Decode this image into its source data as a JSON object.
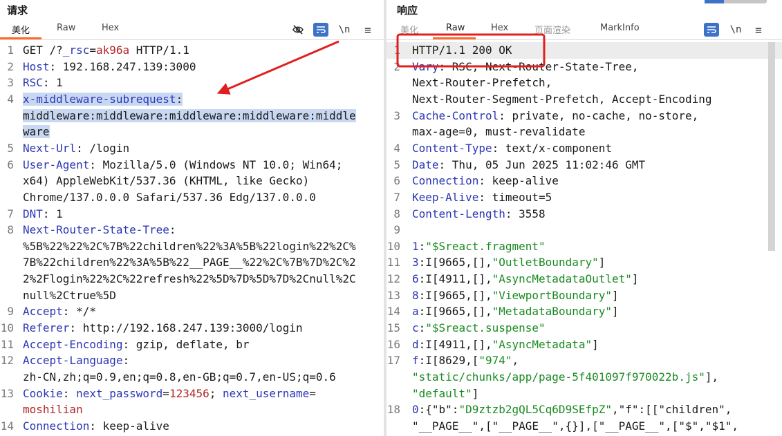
{
  "request": {
    "title": "请求",
    "tabs": [
      "美化",
      "Raw",
      "Hex"
    ],
    "lines": [
      {
        "n": "1",
        "parts": [
          [
            "GET /?",
            "v"
          ],
          [
            "_rsc",
            "k"
          ],
          [
            "=",
            "v"
          ],
          [
            "ak96a",
            "r"
          ],
          [
            " HTTP/1.1",
            "v"
          ]
        ]
      },
      {
        "n": "2",
        "parts": [
          [
            "Host",
            "k"
          ],
          [
            ": 192.168.247.139:3000",
            "v"
          ]
        ]
      },
      {
        "n": "3",
        "parts": [
          [
            "RSC",
            "k"
          ],
          [
            ": 1",
            "v"
          ]
        ]
      },
      {
        "n": "4",
        "parts": [
          [
            "x-middleware-subrequest",
            "k"
          ],
          [
            ":",
            "v"
          ]
        ],
        "sel": true
      },
      {
        "n": "",
        "parts": [
          [
            "middleware:middleware:middleware:middleware:middle",
            "v"
          ]
        ],
        "sel": true
      },
      {
        "n": "",
        "parts": [
          [
            "ware",
            "v"
          ]
        ],
        "sel": true
      },
      {
        "n": "5",
        "parts": [
          [
            "Next-Url",
            "k"
          ],
          [
            ": /login",
            "v"
          ]
        ]
      },
      {
        "n": "6",
        "parts": [
          [
            "User-Agent",
            "k"
          ],
          [
            ": Mozilla/5.0 (Windows NT 10.0; Win64;",
            "v"
          ]
        ]
      },
      {
        "n": "",
        "parts": [
          [
            "x64) AppleWebKit/537.36 (KHTML, like Gecko)",
            "v"
          ]
        ]
      },
      {
        "n": "",
        "parts": [
          [
            "Chrome/137.0.0.0 Safari/537.36 Edg/137.0.0.0",
            "v"
          ]
        ]
      },
      {
        "n": "7",
        "parts": [
          [
            "DNT",
            "k"
          ],
          [
            ": 1",
            "v"
          ]
        ]
      },
      {
        "n": "8",
        "parts": [
          [
            "Next-Router-State-Tree",
            "k"
          ],
          [
            ":",
            "v"
          ]
        ]
      },
      {
        "n": "",
        "parts": [
          [
            "%5B%22%22%2C%7B%22children%22%3A%5B%22login%22%2C%",
            "v"
          ]
        ]
      },
      {
        "n": "",
        "parts": [
          [
            "7B%22children%22%3A%5B%22__PAGE__%22%2C%7B%7D%2C%2",
            "v"
          ]
        ]
      },
      {
        "n": "",
        "parts": [
          [
            "2%2Flogin%22%2C%22refresh%22%5D%7D%5D%7D%2Cnull%2C",
            "v"
          ]
        ]
      },
      {
        "n": "",
        "parts": [
          [
            "null%2Ctrue%5D",
            "v"
          ]
        ]
      },
      {
        "n": "9",
        "parts": [
          [
            "Accept",
            "k"
          ],
          [
            ": */*",
            "v"
          ]
        ]
      },
      {
        "n": "10",
        "parts": [
          [
            "Referer",
            "k"
          ],
          [
            ": http://192.168.247.139:3000/login",
            "v"
          ]
        ]
      },
      {
        "n": "11",
        "parts": [
          [
            "Accept-Encoding",
            "k"
          ],
          [
            ": gzip, deflate, br",
            "v"
          ]
        ]
      },
      {
        "n": "12",
        "parts": [
          [
            "Accept-Language",
            "k"
          ],
          [
            ":",
            "v"
          ]
        ]
      },
      {
        "n": "",
        "parts": [
          [
            "zh-CN,zh;q=0.9,en;q=0.8,en-GB;q=0.7,en-US;q=0.6",
            "v"
          ]
        ]
      },
      {
        "n": "13",
        "parts": [
          [
            "Cookie",
            "k"
          ],
          [
            ": ",
            "v"
          ],
          [
            "next_password",
            "k"
          ],
          [
            "=",
            "v"
          ],
          [
            "123456",
            "r"
          ],
          [
            "; ",
            "v"
          ],
          [
            "next_username",
            "k"
          ],
          [
            "=",
            "v"
          ]
        ]
      },
      {
        "n": "",
        "parts": [
          [
            "moshilian",
            "r"
          ]
        ]
      },
      {
        "n": "14",
        "parts": [
          [
            "Connection",
            "k"
          ],
          [
            ": keep-alive",
            "v"
          ]
        ]
      }
    ]
  },
  "response": {
    "title": "响应",
    "tabs": [
      "美化",
      "Raw",
      "Hex",
      "页面渲染",
      "MarkInfo"
    ],
    "lines": [
      {
        "n": "1",
        "parts": [
          [
            "HTTP/1.1 200 OK",
            "v"
          ]
        ]
      },
      {
        "n": "2",
        "parts": [
          [
            "Vary",
            "k"
          ],
          [
            ": RSC, Next-Router-State-Tree,",
            "v"
          ]
        ]
      },
      {
        "n": "",
        "parts": [
          [
            "Next-Router-Prefetch,",
            "v"
          ]
        ]
      },
      {
        "n": "",
        "parts": [
          [
            "Next-Router-Segment-Prefetch, Accept-Encoding",
            "v"
          ]
        ]
      },
      {
        "n": "3",
        "parts": [
          [
            "Cache-Control",
            "k"
          ],
          [
            ": private, no-cache, no-store,",
            "v"
          ]
        ]
      },
      {
        "n": "",
        "parts": [
          [
            "max-age=0, must-revalidate",
            "v"
          ]
        ]
      },
      {
        "n": "4",
        "parts": [
          [
            "Content-Type",
            "k"
          ],
          [
            ": text/x-component",
            "v"
          ]
        ]
      },
      {
        "n": "5",
        "parts": [
          [
            "Date",
            "k"
          ],
          [
            ": Thu, 05 Jun 2025 11:02:46 GMT",
            "v"
          ]
        ]
      },
      {
        "n": "6",
        "parts": [
          [
            "Connection",
            "k"
          ],
          [
            ": keep-alive",
            "v"
          ]
        ]
      },
      {
        "n": "7",
        "parts": [
          [
            "Keep-Alive",
            "k"
          ],
          [
            ": timeout=5",
            "v"
          ]
        ]
      },
      {
        "n": "8",
        "parts": [
          [
            "Content-Length",
            "k"
          ],
          [
            ": 3558",
            "v"
          ]
        ]
      },
      {
        "n": "9",
        "parts": [
          [
            "",
            "v"
          ]
        ]
      },
      {
        "n": "10",
        "parts": [
          [
            "1",
            "k"
          ],
          [
            ":",
            "v"
          ],
          [
            "\"$Sreact.fragment\"",
            "s"
          ]
        ]
      },
      {
        "n": "11",
        "parts": [
          [
            "3",
            "k"
          ],
          [
            ":I[9665,[],",
            "v"
          ],
          [
            "\"OutletBoundary\"",
            "s"
          ],
          [
            "]",
            "v"
          ]
        ]
      },
      {
        "n": "12",
        "parts": [
          [
            "6",
            "k"
          ],
          [
            ":I[4911,[],",
            "v"
          ],
          [
            "\"AsyncMetadataOutlet\"",
            "s"
          ],
          [
            "]",
            "v"
          ]
        ]
      },
      {
        "n": "13",
        "parts": [
          [
            "8",
            "k"
          ],
          [
            ":I[9665,[],",
            "v"
          ],
          [
            "\"ViewportBoundary\"",
            "s"
          ],
          [
            "]",
            "v"
          ]
        ]
      },
      {
        "n": "14",
        "parts": [
          [
            "a",
            "k"
          ],
          [
            ":I[9665,[],",
            "v"
          ],
          [
            "\"MetadataBoundary\"",
            "s"
          ],
          [
            "]",
            "v"
          ]
        ]
      },
      {
        "n": "15",
        "parts": [
          [
            "c",
            "k"
          ],
          [
            ":",
            "v"
          ],
          [
            "\"$Sreact.suspense\"",
            "s"
          ]
        ]
      },
      {
        "n": "16",
        "parts": [
          [
            "d",
            "k"
          ],
          [
            ":I[4911,[],",
            "v"
          ],
          [
            "\"AsyncMetadata\"",
            "s"
          ],
          [
            "]",
            "v"
          ]
        ]
      },
      {
        "n": "17",
        "parts": [
          [
            "f",
            "k"
          ],
          [
            ":I[8629,[",
            "v"
          ],
          [
            "\"974\"",
            "s"
          ],
          [
            ",",
            "v"
          ]
        ]
      },
      {
        "n": "",
        "parts": [
          [
            "\"static/chunks/app/page-5f401097f970022b.js\"",
            "s"
          ],
          [
            "],",
            "v"
          ]
        ]
      },
      {
        "n": "",
        "parts": [
          [
            "\"default\"",
            "s"
          ],
          [
            "]",
            "v"
          ]
        ]
      },
      {
        "n": "18",
        "parts": [
          [
            "0",
            "k"
          ],
          [
            ":{\"b\":",
            "v"
          ],
          [
            "\"D9ztzb2gQL5Cq6D9SEfpZ\"",
            "s"
          ],
          [
            ",\"f\":[[\"children\",",
            "v"
          ]
        ]
      },
      {
        "n": "",
        "parts": [
          [
            "\"__PAGE__\",[\"__PAGE__\",{}],[\"__PAGE__\",[\"$\",\"$1\",",
            "v"
          ]
        ]
      }
    ]
  },
  "icons": {
    "req_toolbar": [
      "eye-off-icon",
      "wrap-icon",
      "newline-icon",
      "menu-icon"
    ],
    "resp_toolbar": [
      "wrap-icon",
      "newline-icon",
      "menu-icon"
    ],
    "newline_glyph": "\\n",
    "menu_glyph": "≡"
  },
  "colors": {
    "key": "#2a36b4",
    "value": "#1a1a1a",
    "red_value": "#b32424",
    "string": "#1a8b22",
    "selection": "#c9d8f2",
    "annotation": "#e02020",
    "tab_accent": "#ff6a2a"
  }
}
